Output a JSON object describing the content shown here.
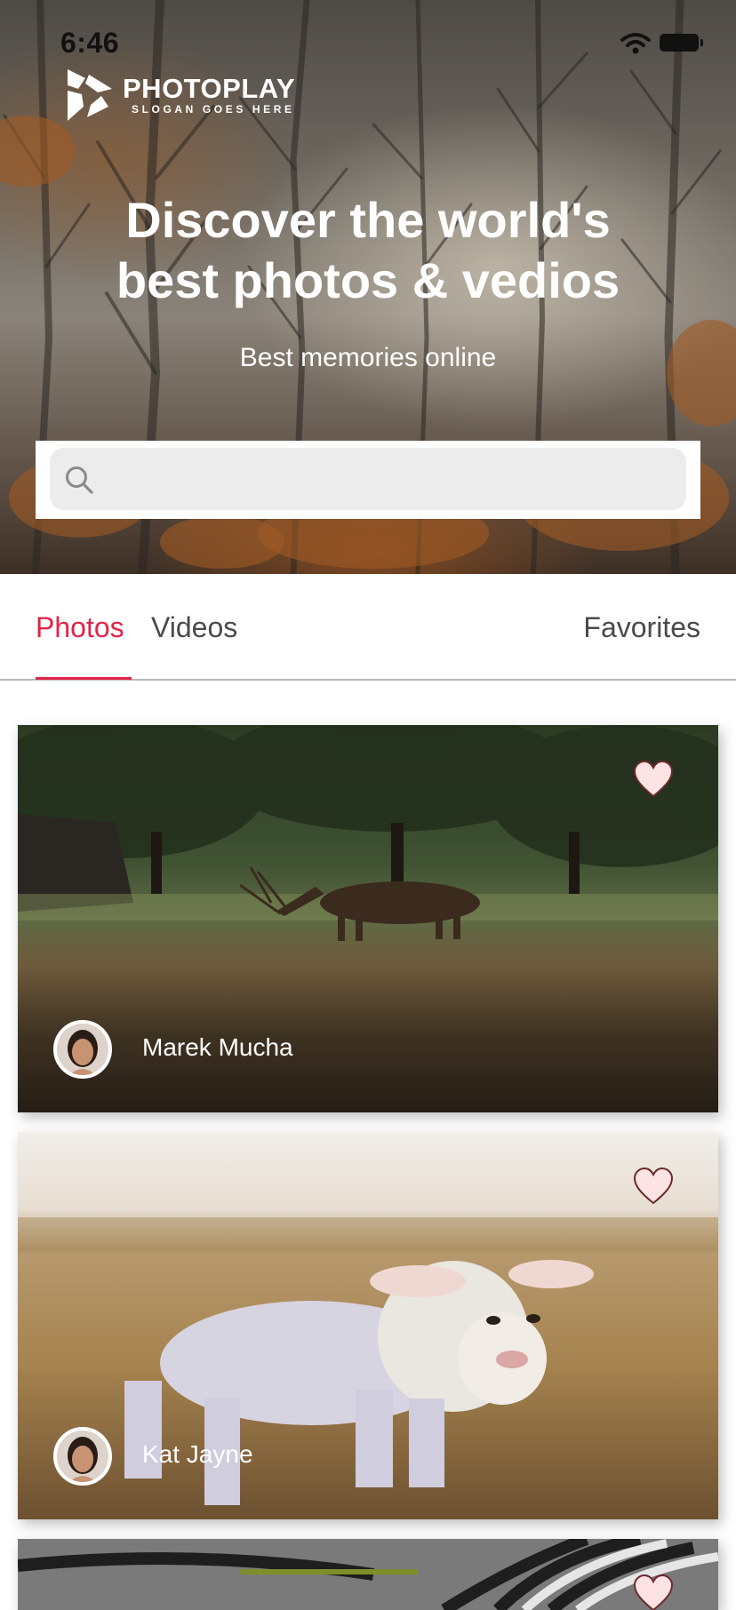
{
  "status_bar": {
    "time": "6:46"
  },
  "brand": {
    "name": "PHOTOPLAY",
    "slogan": "SLOGAN GOES HERE"
  },
  "hero": {
    "title_line1": "Discover the world's",
    "title_line2": "best photos & vedios",
    "subtitle": "Best memories online"
  },
  "search": {
    "value": "",
    "placeholder": ""
  },
  "tabs": [
    {
      "label": "Photos",
      "active": true
    },
    {
      "label": "Videos",
      "active": false
    },
    {
      "label": "Favorites",
      "active": false
    }
  ],
  "cards": [
    {
      "author": "Marek Mucha",
      "favorite": false
    },
    {
      "author": "Kat Jayne",
      "favorite": false
    },
    {
      "author": "",
      "favorite": false
    }
  ],
  "colors": {
    "accent": "#e0244a",
    "tab_text": "#4a4a4a",
    "heart_fill": "#fde3e3",
    "heart_stroke": "#6a2a2a",
    "search_bg": "#ececec"
  },
  "icons": [
    "wifi-icon",
    "battery-icon",
    "photoplay-logo-icon",
    "search-icon",
    "heart-icon"
  ]
}
